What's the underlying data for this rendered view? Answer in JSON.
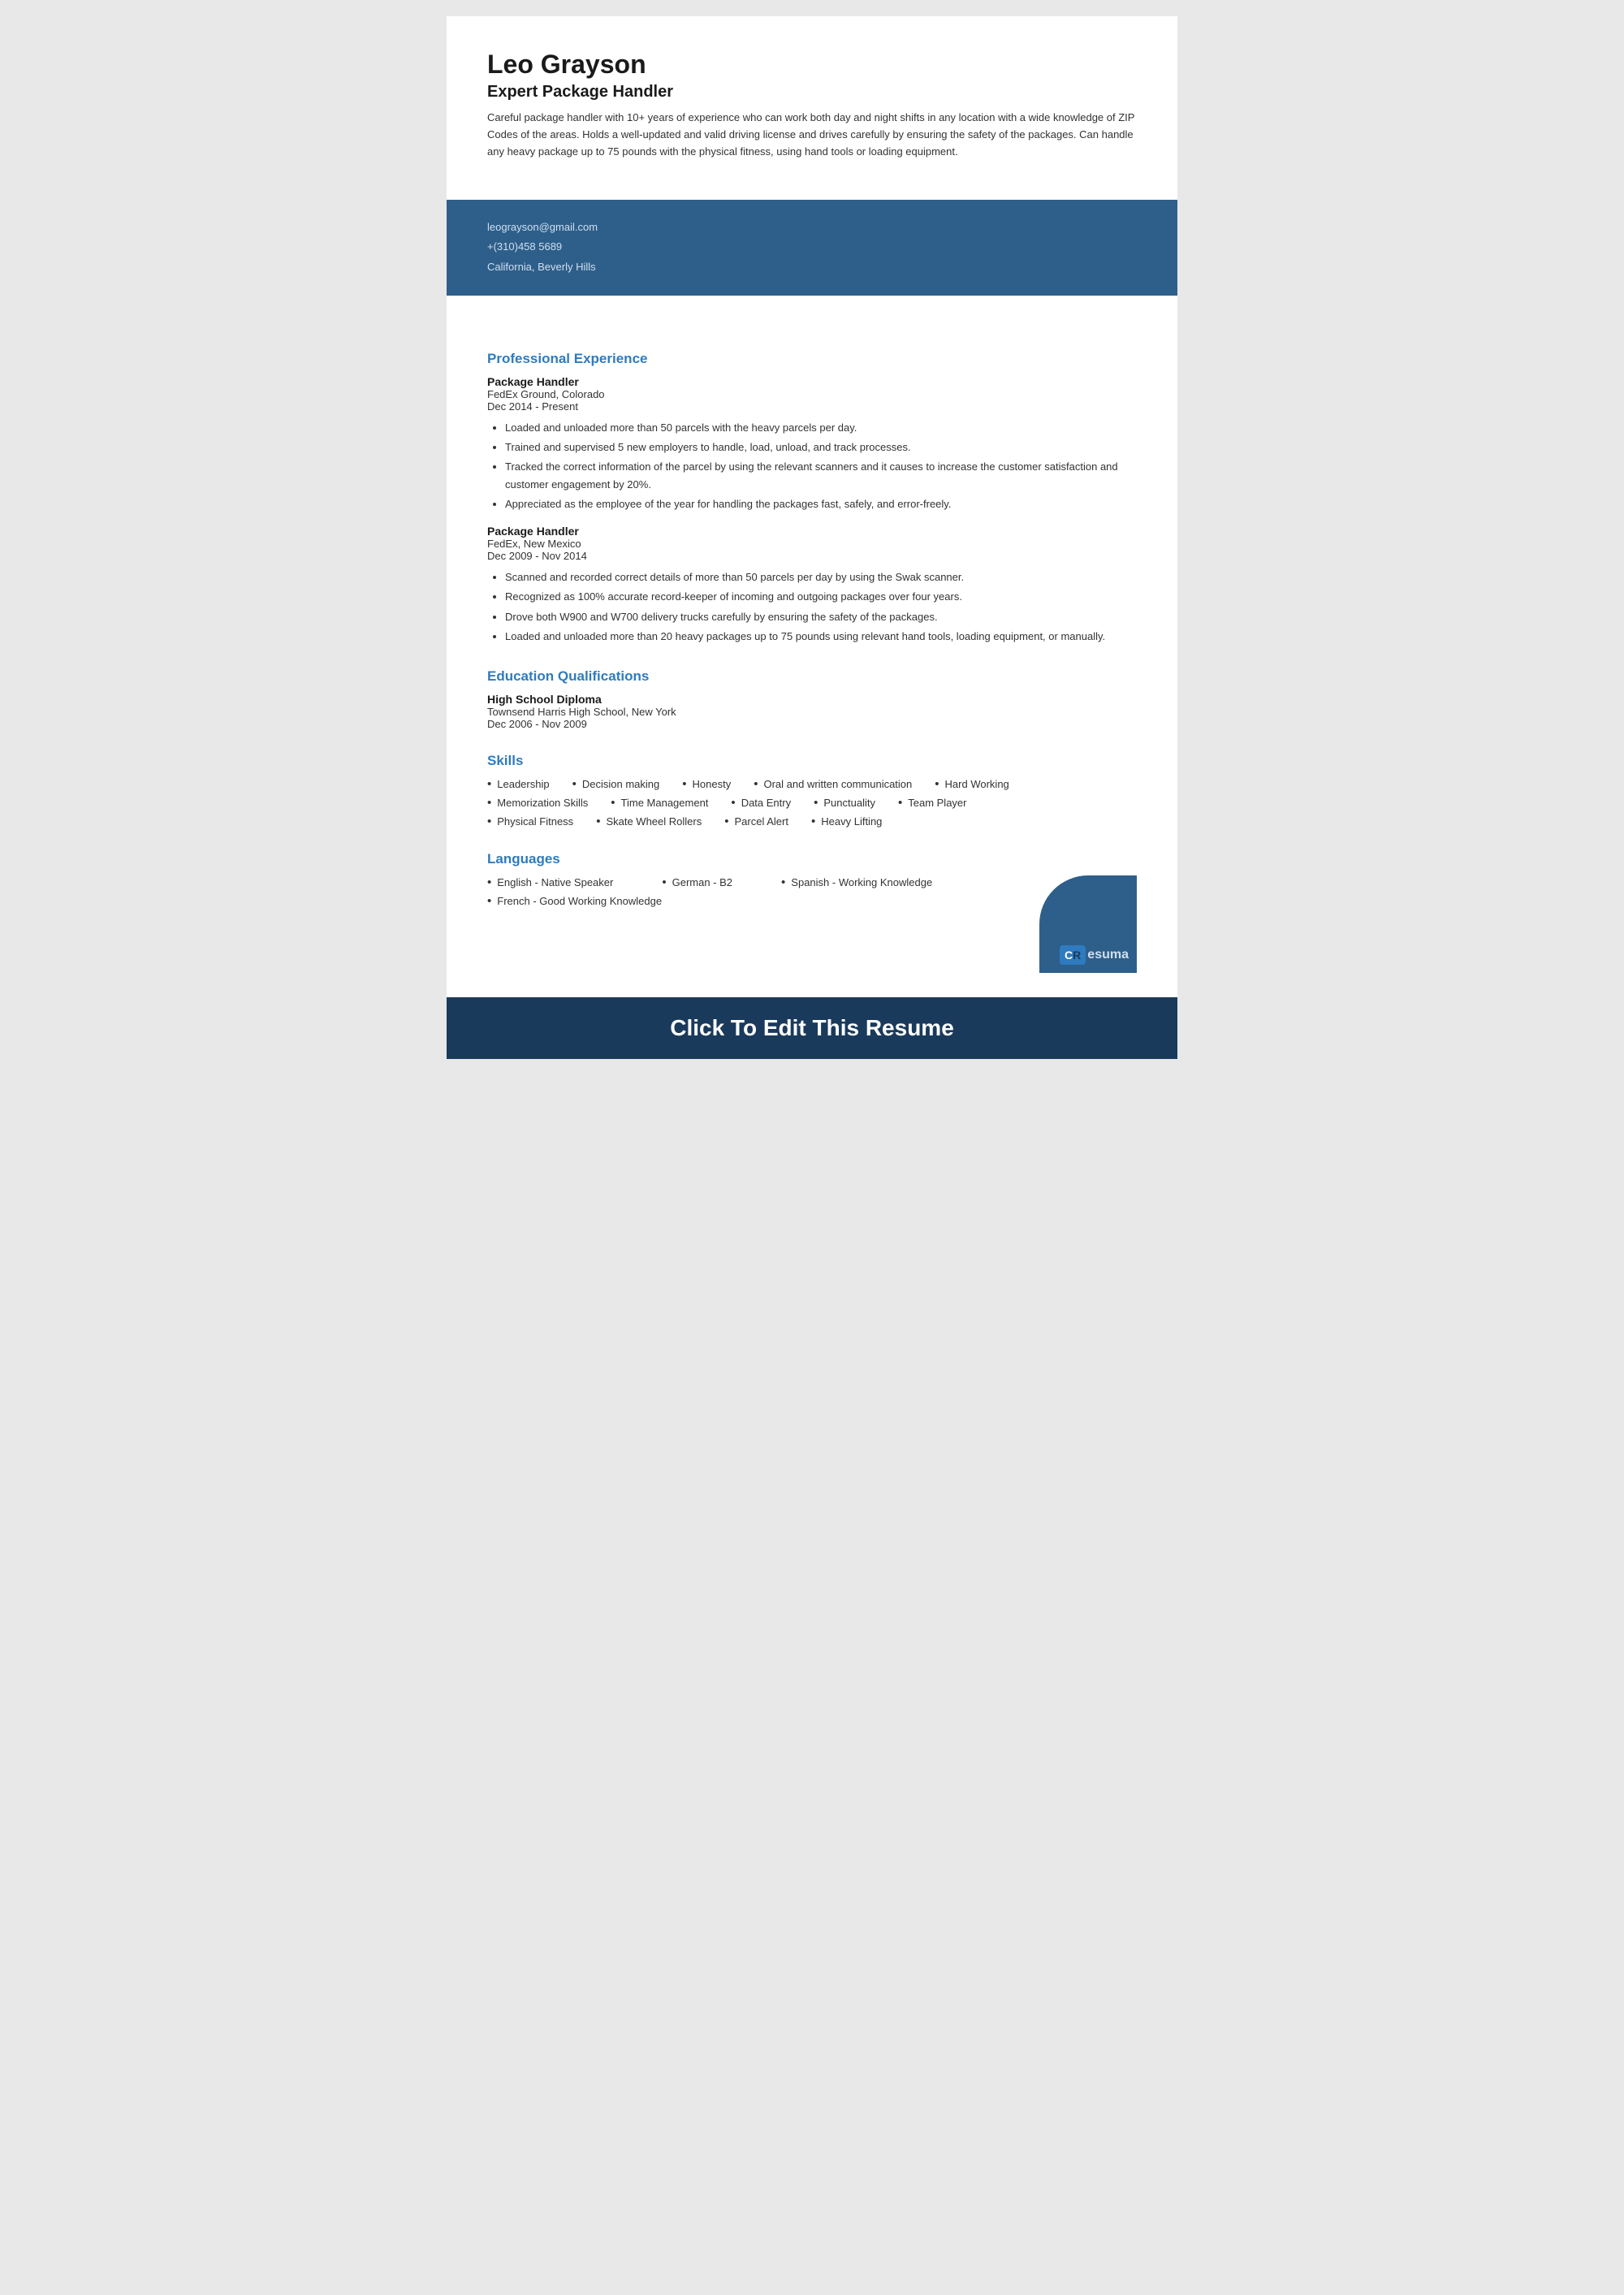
{
  "header": {
    "name": "Leo Grayson",
    "title": "Expert Package Handler",
    "summary": "Careful package handler with 10+ years of experience who can work both day and night shifts in any location with a wide knowledge of ZIP Codes of the areas. Holds a well-updated and valid driving license and drives carefully by ensuring the safety of the packages. Can handle any heavy package up to 75 pounds with the physical fitness, using hand tools or loading equipment."
  },
  "contact": {
    "email": "leograyson@gmail.com",
    "phone": "+(310)458 5689",
    "location": "California, Beverly Hills"
  },
  "sections": {
    "experience_title": "Professional Experience",
    "education_title": "Education Qualifications",
    "skills_title": "Skills",
    "languages_title": "Languages"
  },
  "experience": [
    {
      "job_title": "Package Handler",
      "company": "FedEx Ground, Colorado",
      "dates": "Dec 2014 - Present",
      "bullets": [
        "Loaded and unloaded more than 50 parcels with the heavy parcels per day.",
        "Trained and supervised 5 new employers to handle, load, unload, and track processes.",
        "Tracked the correct information of the parcel by using the relevant scanners and it causes to increase the customer satisfaction and customer engagement by 20%.",
        "Appreciated as the employee of the year for handling the packages fast, safely, and error-freely."
      ]
    },
    {
      "job_title": "Package Handler",
      "company": "FedEx, New Mexico",
      "dates": "Dec 2009 - Nov 2014",
      "bullets": [
        "Scanned and recorded correct details of more than 50 parcels per day by using the Swak scanner.",
        "Recognized as 100% accurate record-keeper of incoming and outgoing packages over four years.",
        "Drove both W900 and W700 delivery trucks carefully by ensuring the safety of the packages.",
        "Loaded and unloaded more than 20 heavy packages up to 75 pounds using relevant hand tools, loading equipment, or manually."
      ]
    }
  ],
  "education": [
    {
      "degree": "High School Diploma",
      "school": "Townsend Harris High School, New York",
      "dates": "Dec 2006 - Nov 2009"
    }
  ],
  "skills": {
    "rows": [
      [
        "Leadership",
        "Decision making",
        "Honesty",
        "Oral and written communication",
        "Hard Working"
      ],
      [
        "Memorization Skills",
        "Time Management",
        "Data Entry",
        "Punctuality",
        "Team Player"
      ],
      [
        "Physical Fitness",
        "Skate Wheel Rollers",
        "Parcel Alert",
        "Heavy Lifting"
      ]
    ]
  },
  "languages": {
    "rows": [
      [
        "English - Native Speaker",
        "German - B2",
        "Spanish - Working Knowledge"
      ],
      [
        "French - Good Working Knowledge"
      ]
    ]
  },
  "cta": {
    "label": "Click To Edit This Resume"
  },
  "brand": {
    "logo_text": "C",
    "logo_suffix": "R",
    "name_part": "esuma"
  }
}
